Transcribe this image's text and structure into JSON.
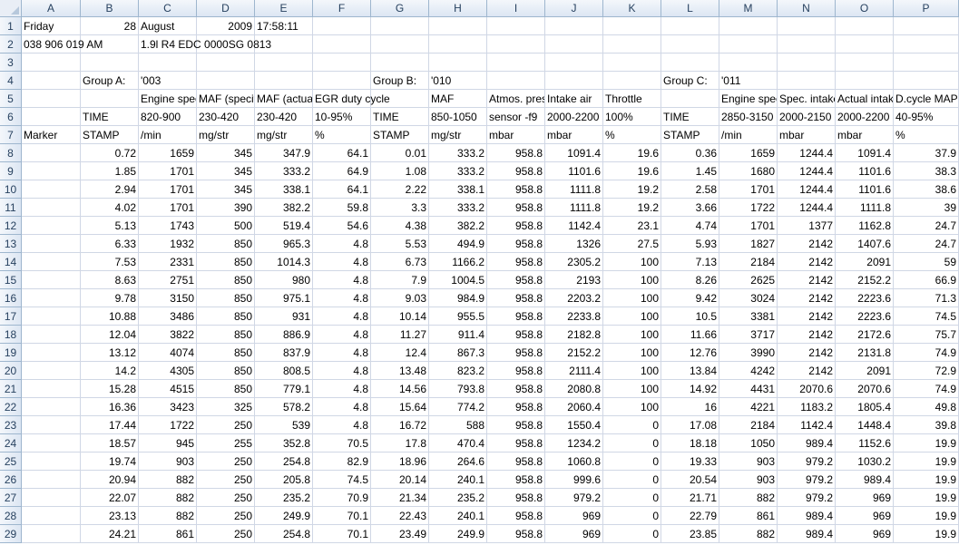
{
  "columns": [
    "A",
    "B",
    "C",
    "D",
    "E",
    "F",
    "G",
    "H",
    "I",
    "J",
    "K",
    "L",
    "M",
    "N",
    "O",
    "P"
  ],
  "rows": [
    [
      "Friday",
      "28",
      "August",
      "2009",
      "17:58:11",
      "",
      "",
      "",
      "",
      "",
      "",
      "",
      "",
      "",
      "",
      ""
    ],
    [
      "038 906 019 AM",
      "",
      "1.9l R4 EDC 0000SG  0813",
      "",
      "",
      "",
      "",
      "",
      "",
      "",
      "",
      "",
      "",
      "",
      "",
      ""
    ],
    [
      "",
      "",
      "",
      "",
      "",
      "",
      "",
      "",
      "",
      "",
      "",
      "",
      "",
      "",
      "",
      ""
    ],
    [
      "",
      "Group A:",
      "'003",
      "",
      "",
      "",
      "Group B:",
      "'010",
      "",
      "",
      "",
      "Group C:",
      "'011",
      "",
      "",
      ""
    ],
    [
      "",
      "",
      "Engine speed",
      "MAF (specified)",
      "MAF (actual)",
      "EGR duty cycle",
      "",
      "MAF",
      "Atmos. pressure",
      "Intake air",
      "Throttle",
      "",
      "Engine speed",
      "Spec. intake",
      "Actual intake",
      "D.cycle MAP"
    ],
    [
      "",
      "TIME",
      "820-900",
      "230-420",
      "230-420",
      "10-95%",
      "TIME",
      "850-1050",
      "sensor -f9",
      "2000-2200",
      "100%",
      "TIME",
      "2850-3150",
      "2000-2150",
      "2000-2200",
      "40-95%"
    ],
    [
      "Marker",
      "STAMP",
      "/min",
      "mg/str",
      "mg/str",
      "%",
      "STAMP",
      "mg/str",
      "mbar",
      "mbar",
      "%",
      "STAMP",
      "/min",
      "mbar",
      "mbar",
      "%"
    ],
    [
      "",
      "0.72",
      "1659",
      "345",
      "347.9",
      "64.1",
      "0.01",
      "333.2",
      "958.8",
      "1091.4",
      "19.6",
      "0.36",
      "1659",
      "1244.4",
      "1091.4",
      "37.9"
    ],
    [
      "",
      "1.85",
      "1701",
      "345",
      "333.2",
      "64.9",
      "1.08",
      "333.2",
      "958.8",
      "1101.6",
      "19.6",
      "1.45",
      "1680",
      "1244.4",
      "1101.6",
      "38.3"
    ],
    [
      "",
      "2.94",
      "1701",
      "345",
      "338.1",
      "64.1",
      "2.22",
      "338.1",
      "958.8",
      "1111.8",
      "19.2",
      "2.58",
      "1701",
      "1244.4",
      "1101.6",
      "38.6"
    ],
    [
      "",
      "4.02",
      "1701",
      "390",
      "382.2",
      "59.8",
      "3.3",
      "333.2",
      "958.8",
      "1111.8",
      "19.2",
      "3.66",
      "1722",
      "1244.4",
      "1111.8",
      "39"
    ],
    [
      "",
      "5.13",
      "1743",
      "500",
      "519.4",
      "54.6",
      "4.38",
      "382.2",
      "958.8",
      "1142.4",
      "23.1",
      "4.74",
      "1701",
      "1377",
      "1162.8",
      "24.7"
    ],
    [
      "",
      "6.33",
      "1932",
      "850",
      "965.3",
      "4.8",
      "5.53",
      "494.9",
      "958.8",
      "1326",
      "27.5",
      "5.93",
      "1827",
      "2142",
      "1407.6",
      "24.7"
    ],
    [
      "",
      "7.53",
      "2331",
      "850",
      "1014.3",
      "4.8",
      "6.73",
      "1166.2",
      "958.8",
      "2305.2",
      "100",
      "7.13",
      "2184",
      "2142",
      "2091",
      "59"
    ],
    [
      "",
      "8.63",
      "2751",
      "850",
      "980",
      "4.8",
      "7.9",
      "1004.5",
      "958.8",
      "2193",
      "100",
      "8.26",
      "2625",
      "2142",
      "2152.2",
      "66.9"
    ],
    [
      "",
      "9.78",
      "3150",
      "850",
      "975.1",
      "4.8",
      "9.03",
      "984.9",
      "958.8",
      "2203.2",
      "100",
      "9.42",
      "3024",
      "2142",
      "2223.6",
      "71.3"
    ],
    [
      "",
      "10.88",
      "3486",
      "850",
      "931",
      "4.8",
      "10.14",
      "955.5",
      "958.8",
      "2233.8",
      "100",
      "10.5",
      "3381",
      "2142",
      "2223.6",
      "74.5"
    ],
    [
      "",
      "12.04",
      "3822",
      "850",
      "886.9",
      "4.8",
      "11.27",
      "911.4",
      "958.8",
      "2182.8",
      "100",
      "11.66",
      "3717",
      "2142",
      "2172.6",
      "75.7"
    ],
    [
      "",
      "13.12",
      "4074",
      "850",
      "837.9",
      "4.8",
      "12.4",
      "867.3",
      "958.8",
      "2152.2",
      "100",
      "12.76",
      "3990",
      "2142",
      "2131.8",
      "74.9"
    ],
    [
      "",
      "14.2",
      "4305",
      "850",
      "808.5",
      "4.8",
      "13.48",
      "823.2",
      "958.8",
      "2111.4",
      "100",
      "13.84",
      "4242",
      "2142",
      "2091",
      "72.9"
    ],
    [
      "",
      "15.28",
      "4515",
      "850",
      "779.1",
      "4.8",
      "14.56",
      "793.8",
      "958.8",
      "2080.8",
      "100",
      "14.92",
      "4431",
      "2070.6",
      "2070.6",
      "74.9"
    ],
    [
      "",
      "16.36",
      "3423",
      "325",
      "578.2",
      "4.8",
      "15.64",
      "774.2",
      "958.8",
      "2060.4",
      "100",
      "16",
      "4221",
      "1183.2",
      "1805.4",
      "49.8"
    ],
    [
      "",
      "17.44",
      "1722",
      "250",
      "539",
      "4.8",
      "16.72",
      "588",
      "958.8",
      "1550.4",
      "0",
      "17.08",
      "2184",
      "1142.4",
      "1448.4",
      "39.8"
    ],
    [
      "",
      "18.57",
      "945",
      "255",
      "352.8",
      "70.5",
      "17.8",
      "470.4",
      "958.8",
      "1234.2",
      "0",
      "18.18",
      "1050",
      "989.4",
      "1152.6",
      "19.9"
    ],
    [
      "",
      "19.74",
      "903",
      "250",
      "254.8",
      "82.9",
      "18.96",
      "264.6",
      "958.8",
      "1060.8",
      "0",
      "19.33",
      "903",
      "979.2",
      "1030.2",
      "19.9"
    ],
    [
      "",
      "20.94",
      "882",
      "250",
      "205.8",
      "74.5",
      "20.14",
      "240.1",
      "958.8",
      "999.6",
      "0",
      "20.54",
      "903",
      "979.2",
      "989.4",
      "19.9"
    ],
    [
      "",
      "22.07",
      "882",
      "250",
      "235.2",
      "70.9",
      "21.34",
      "235.2",
      "958.8",
      "979.2",
      "0",
      "21.71",
      "882",
      "979.2",
      "969",
      "19.9"
    ],
    [
      "",
      "23.13",
      "882",
      "250",
      "249.9",
      "70.1",
      "22.43",
      "240.1",
      "958.8",
      "969",
      "0",
      "22.79",
      "861",
      "989.4",
      "969",
      "19.9"
    ],
    [
      "",
      "24.21",
      "861",
      "250",
      "254.8",
      "70.1",
      "23.49",
      "249.9",
      "958.8",
      "969",
      "0",
      "23.85",
      "882",
      "989.4",
      "969",
      "19.9"
    ]
  ]
}
